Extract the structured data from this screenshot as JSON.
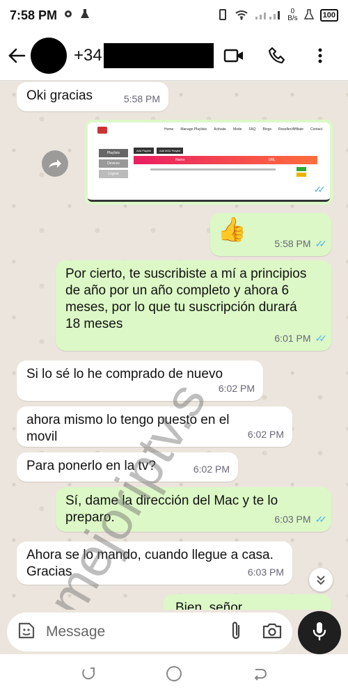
{
  "status": {
    "time": "7:58 PM",
    "net_speed": "0",
    "net_unit": "B/s",
    "battery": "100"
  },
  "header": {
    "contact_prefix": "+34"
  },
  "messages": [
    {
      "text": "Oki gracias",
      "time": "5:58 PM"
    },
    {
      "time": "5:58 PM"
    },
    {
      "emoji": "👍",
      "time": "5:58 PM"
    },
    {
      "text": "Por cierto, te suscribiste a mí a principios de año por un año completo y ahora 6 meses, por lo que tu suscripción durará 18 meses",
      "time": "6:01 PM"
    },
    {
      "text": "Si lo sé lo he comprado de nuevo",
      "time": "6:02 PM"
    },
    {
      "text": "ahora mismo lo tengo puesto en el movil",
      "time": "6:02 PM"
    },
    {
      "text": "Para ponerlo en la tv?",
      "time": "6:02 PM"
    },
    {
      "text": "Sí, dame la dirección del Mac y te lo preparo.",
      "time": "6:03 PM"
    },
    {
      "text": "Ahora se lo mando, cuando llegue a casa. Gracias",
      "time": "6:03 PM"
    },
    {
      "text": "Bien, señor"
    }
  ],
  "screenshot_preview": {
    "nav": [
      "Home",
      "Manage Playlists",
      "Activate",
      "Mode",
      "FAQ",
      "Blogs",
      "Reseller/Affiliate",
      "Contact"
    ],
    "buttons": [
      "Playlists",
      "Devices",
      "Logout"
    ],
    "tabs": [
      "Add Playlist",
      "Add M3U Playlist"
    ],
    "labels": [
      "Name",
      "URL"
    ]
  },
  "watermark": "mejoriptv.s",
  "composer": {
    "placeholder": "Message"
  },
  "colors": {
    "incoming": "#ffffff",
    "outgoing": "#dcf8c6",
    "read_ticks": "#4fb6ec",
    "wallpaper": "#ece5dd"
  }
}
